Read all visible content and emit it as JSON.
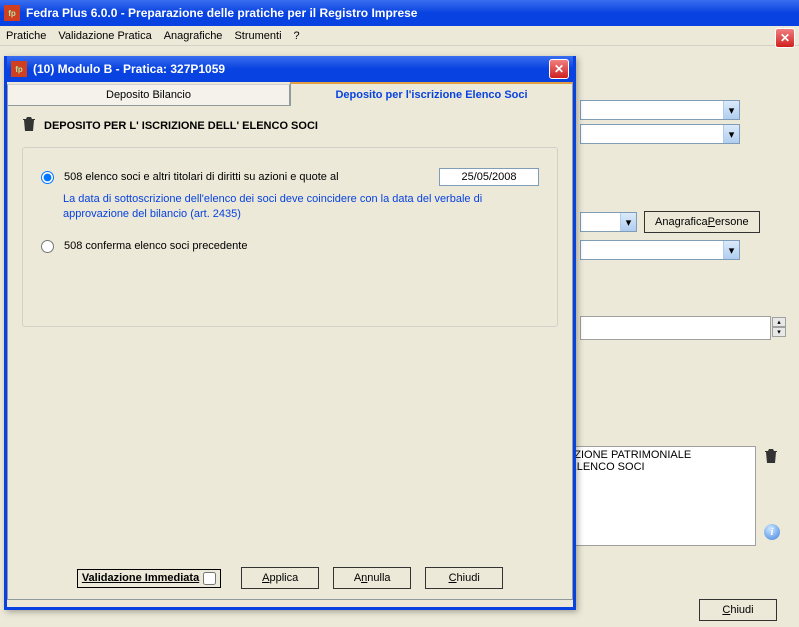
{
  "app": {
    "title": "Fedra Plus 6.0.0 - Preparazione delle pratiche per il Registro Imprese"
  },
  "menu": {
    "pratiche": "Pratiche",
    "validazione": "Validazione Pratica",
    "anagrafiche": "Anagrafiche",
    "strumenti": "Strumenti",
    "help": "?"
  },
  "bg": {
    "anag_btn_prefix": "Anagrafica ",
    "anag_btn_u": "P",
    "anag_btn_rest": "ersone",
    "list": [
      "UAZIONE PATRIMONIALE",
      "E ELENCO SOCI"
    ],
    "chiudi_u": "C",
    "chiudi_rest": "hiudi"
  },
  "dialog": {
    "title": "(10) Modulo B - Pratica: 327P1059",
    "tabs": {
      "deposito": "Deposito Bilancio",
      "iscrizione": "Deposito per l'iscrizione Elenco Soci"
    },
    "section_title": "DEPOSITO PER L' ISCRIZIONE DELL' ELENCO SOCI",
    "radio1_label": "508 elenco soci e altri titolari di diritti su azioni e quote al",
    "date_value": "25/05/2008",
    "hint": "La data di sottoscrizione dell'elenco dei soci deve coincidere con la data del verbale di approvazione del bilancio (art. 2435)",
    "radio2_label": "508 conferma elenco soci precedente",
    "validazione_label": "Validazione Immediata",
    "applica_u": "A",
    "applica_rest": "pplica",
    "annulla_pre": "A",
    "annulla_u": "n",
    "annulla_rest": "nulla",
    "chiudi_u": "C",
    "chiudi_rest": "hiudi"
  }
}
